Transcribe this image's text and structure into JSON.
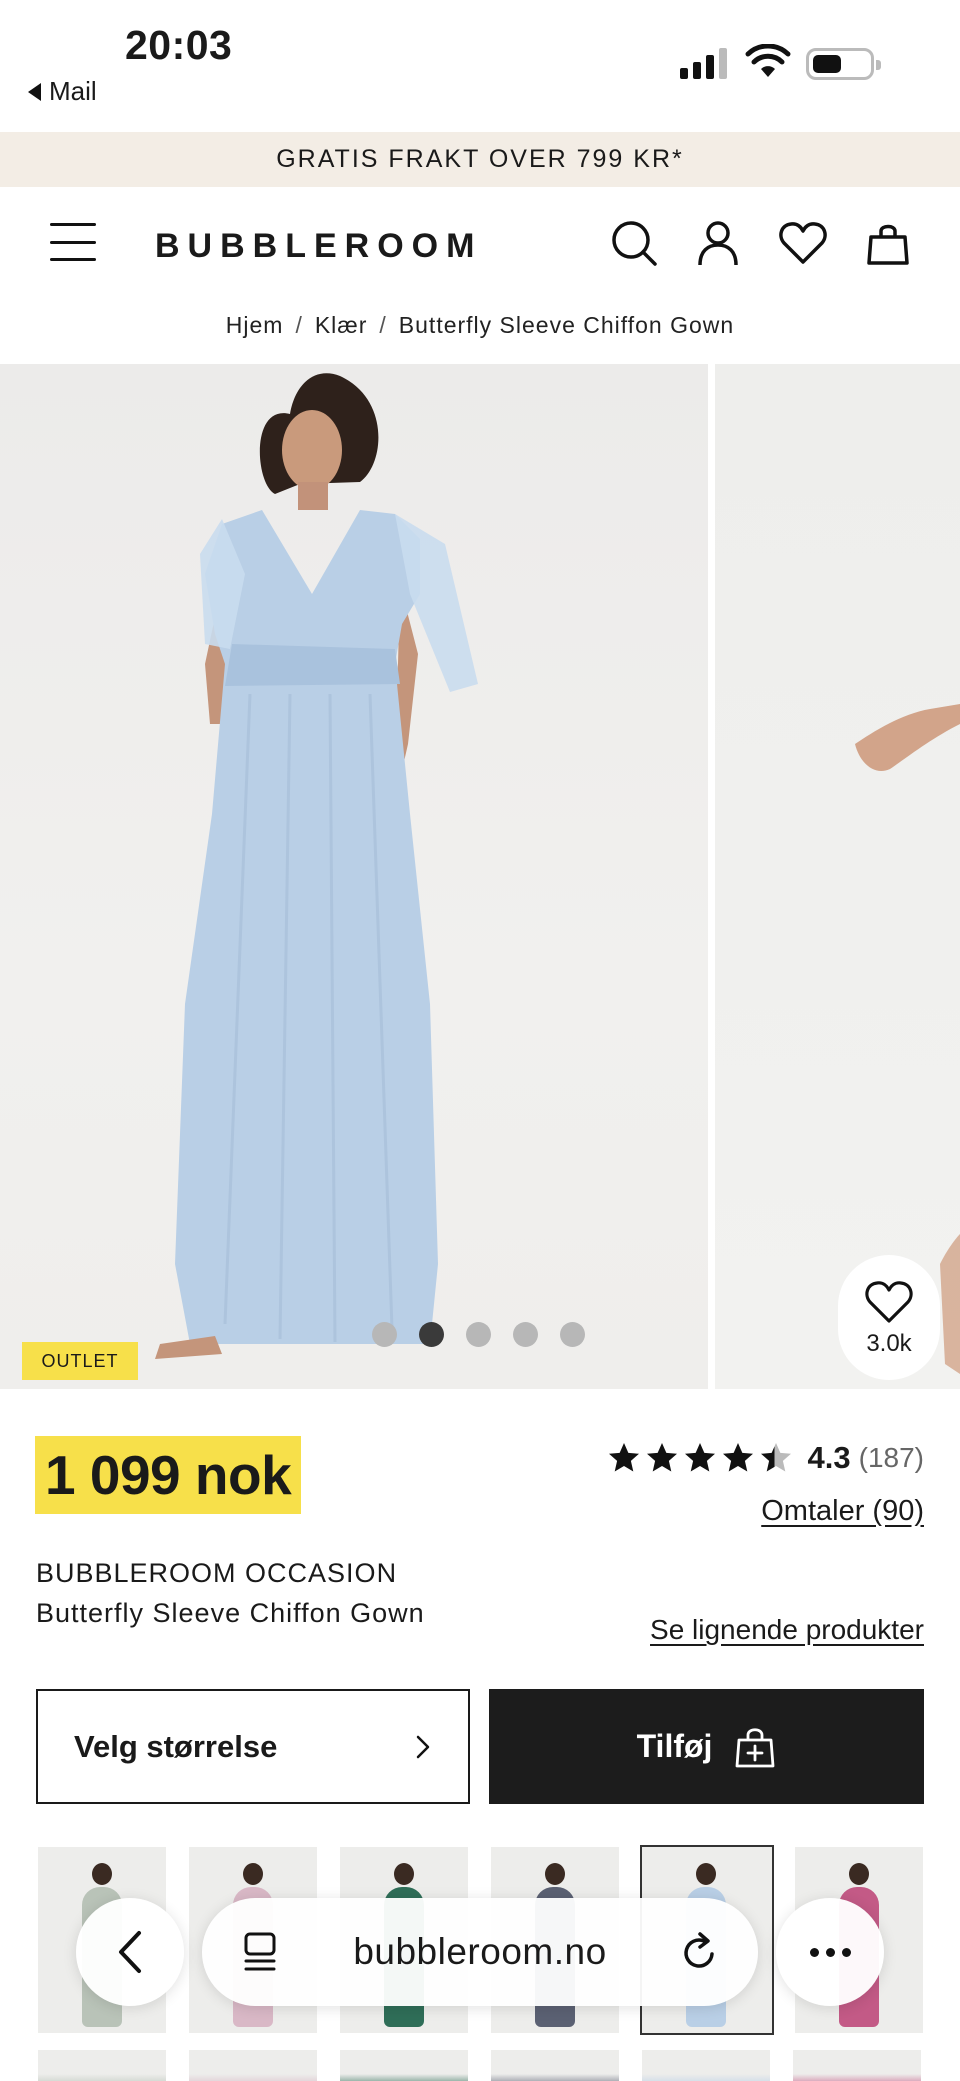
{
  "status_bar": {
    "time": "20:03",
    "back_app": "Mail"
  },
  "promo": {
    "text": "GRATIS FRAKT OVER 799 KR*"
  },
  "header": {
    "logo": "BUBBLEROOM",
    "icons": [
      "menu-icon",
      "search-icon",
      "account-icon",
      "heart-icon",
      "bag-icon"
    ]
  },
  "breadcrumb": {
    "items": [
      "Hjem",
      "Klær",
      "Butterfly Sleeve Chiffon Gown"
    ],
    "separator": "/"
  },
  "gallery": {
    "badge": "OUTLET",
    "wishlist_count": "3.0k",
    "slide_count": 5,
    "active_slide": 1,
    "dress_color": "#b9cfe6"
  },
  "product": {
    "price": "1 099 nok",
    "rating_stars": 4.3,
    "rating_score": "4.3",
    "rating_count": "(187)",
    "reviews_link": "Omtaler (90)",
    "brand": "BUBBLEROOM OCCASION",
    "name": "Butterfly Sleeve Chiffon Gown",
    "similar_link": "Se lignende produkter",
    "size_button": "Velg størrelse",
    "add_button": "Tilføj",
    "accent_color": "#f7e04a"
  },
  "thumbnails": {
    "colors": [
      "#b9c3b8",
      "#d9b8c6",
      "#2f6e58",
      "#5b6173",
      "#b9cfe6",
      "#c35a86"
    ],
    "selected_index": 4
  },
  "browser": {
    "url": "bubbleroom.no"
  }
}
